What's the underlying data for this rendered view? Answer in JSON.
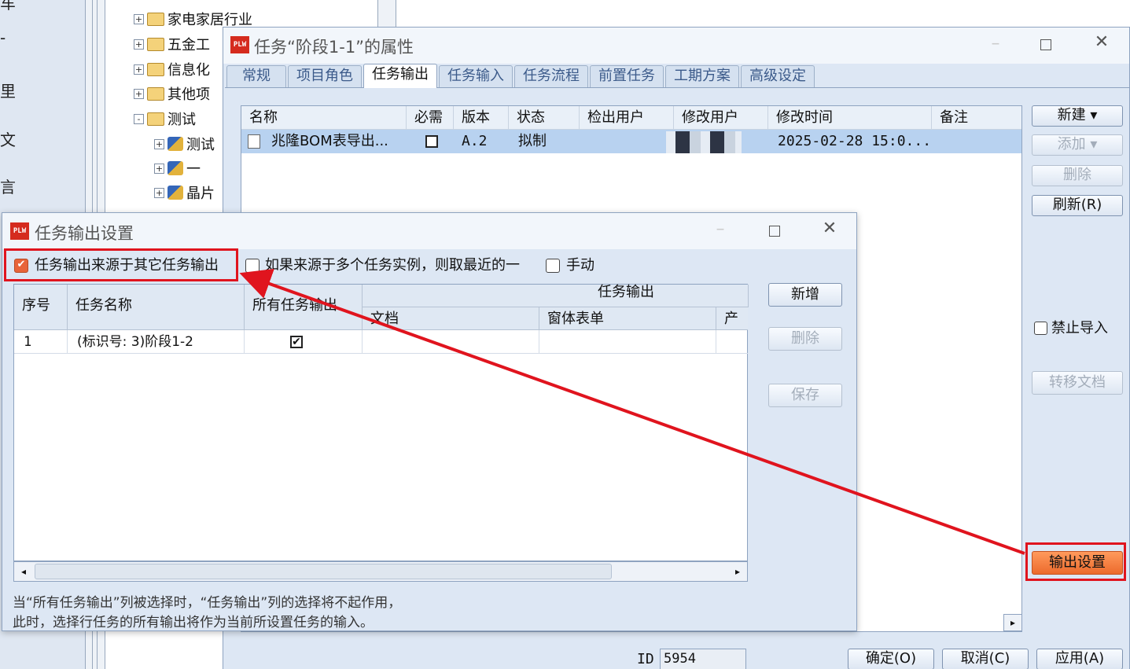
{
  "background": {
    "left_panel_chars": [
      "车",
      "-",
      "里",
      "文",
      "言"
    ],
    "tree": {
      "items": [
        {
          "label": "家电家居行业",
          "kind": "folder",
          "expander": "+"
        },
        {
          "label": "五金工",
          "kind": "folder",
          "expander": "+"
        },
        {
          "label": "信息化",
          "kind": "folder",
          "expander": "+"
        },
        {
          "label": "其他项",
          "kind": "folder",
          "expander": "+"
        },
        {
          "label": "测试",
          "kind": "folder",
          "expander": "-"
        },
        {
          "label": "测试",
          "kind": "task",
          "expander": "+"
        },
        {
          "label": "一",
          "kind": "task",
          "expander": "+"
        },
        {
          "label": "晶片",
          "kind": "task",
          "expander": "+"
        }
      ]
    }
  },
  "properties_dialog": {
    "logo": "PLW",
    "title": "任务“阶段1-1”的属性",
    "tabs": [
      "常规",
      "项目角色",
      "任务输出",
      "任务输入",
      "任务流程",
      "前置任务",
      "工期方案",
      "高级设定"
    ],
    "active_tab": "任务输出",
    "grid": {
      "columns": [
        "名称",
        "必需",
        "版本",
        "状态",
        "检出用户",
        "修改用户",
        "修改时间",
        "备注"
      ],
      "rows": [
        {
          "name": "兆隆BOM表导出...",
          "required": false,
          "version": "A.2",
          "status": "拟制",
          "checkout_user": "",
          "modify_user": "",
          "modify_time": "2025-02-28 15:0...",
          "note": ""
        }
      ]
    },
    "buttons": {
      "new": "新建",
      "add": "添加",
      "delete": "删除",
      "refresh": "刷新(R)",
      "disable_import": "禁止导入",
      "transfer_doc": "转移文档",
      "output_settings": "输出设置"
    },
    "bottom": {
      "id_label": "ID",
      "id_value": "5954",
      "ok": "确定(O)",
      "cancel": "取消(C)",
      "apply": "应用(A)"
    }
  },
  "output_settings_dialog": {
    "logo": "PLW",
    "title": "任务输出设置",
    "options": {
      "from_other_task": {
        "label": "任务输出来源于其它任务输出",
        "checked": true
      },
      "latest_instance": {
        "label": "如果来源于多个任务实例，则取最近的一",
        "checked": false
      },
      "manual": {
        "label": "手动",
        "checked": false
      }
    },
    "grid": {
      "headers": {
        "seq": "序号",
        "task_name": "任务名称",
        "all_outputs": "所有任务输出",
        "task_output_group": "任务输出",
        "document": "文档",
        "form": "窗体表单",
        "product": "产品"
      },
      "rows": [
        {
          "seq": "1",
          "task_name": "(标识号: 3)阶段1-2",
          "all_outputs": true
        }
      ]
    },
    "buttons": {
      "add": "新增",
      "delete": "删除",
      "save": "保存"
    },
    "note_line1": "当“所有任务输出”列被选择时，“任务输出”列的选择将不起作用，",
    "note_line2": "此时，选择行任务的所有输出将作为当前所设置任务的输入。"
  },
  "colors": {
    "annotation_red": "#e0141e",
    "highlight_button": "#f07a3a",
    "selection_row": "#b8d2f0"
  }
}
